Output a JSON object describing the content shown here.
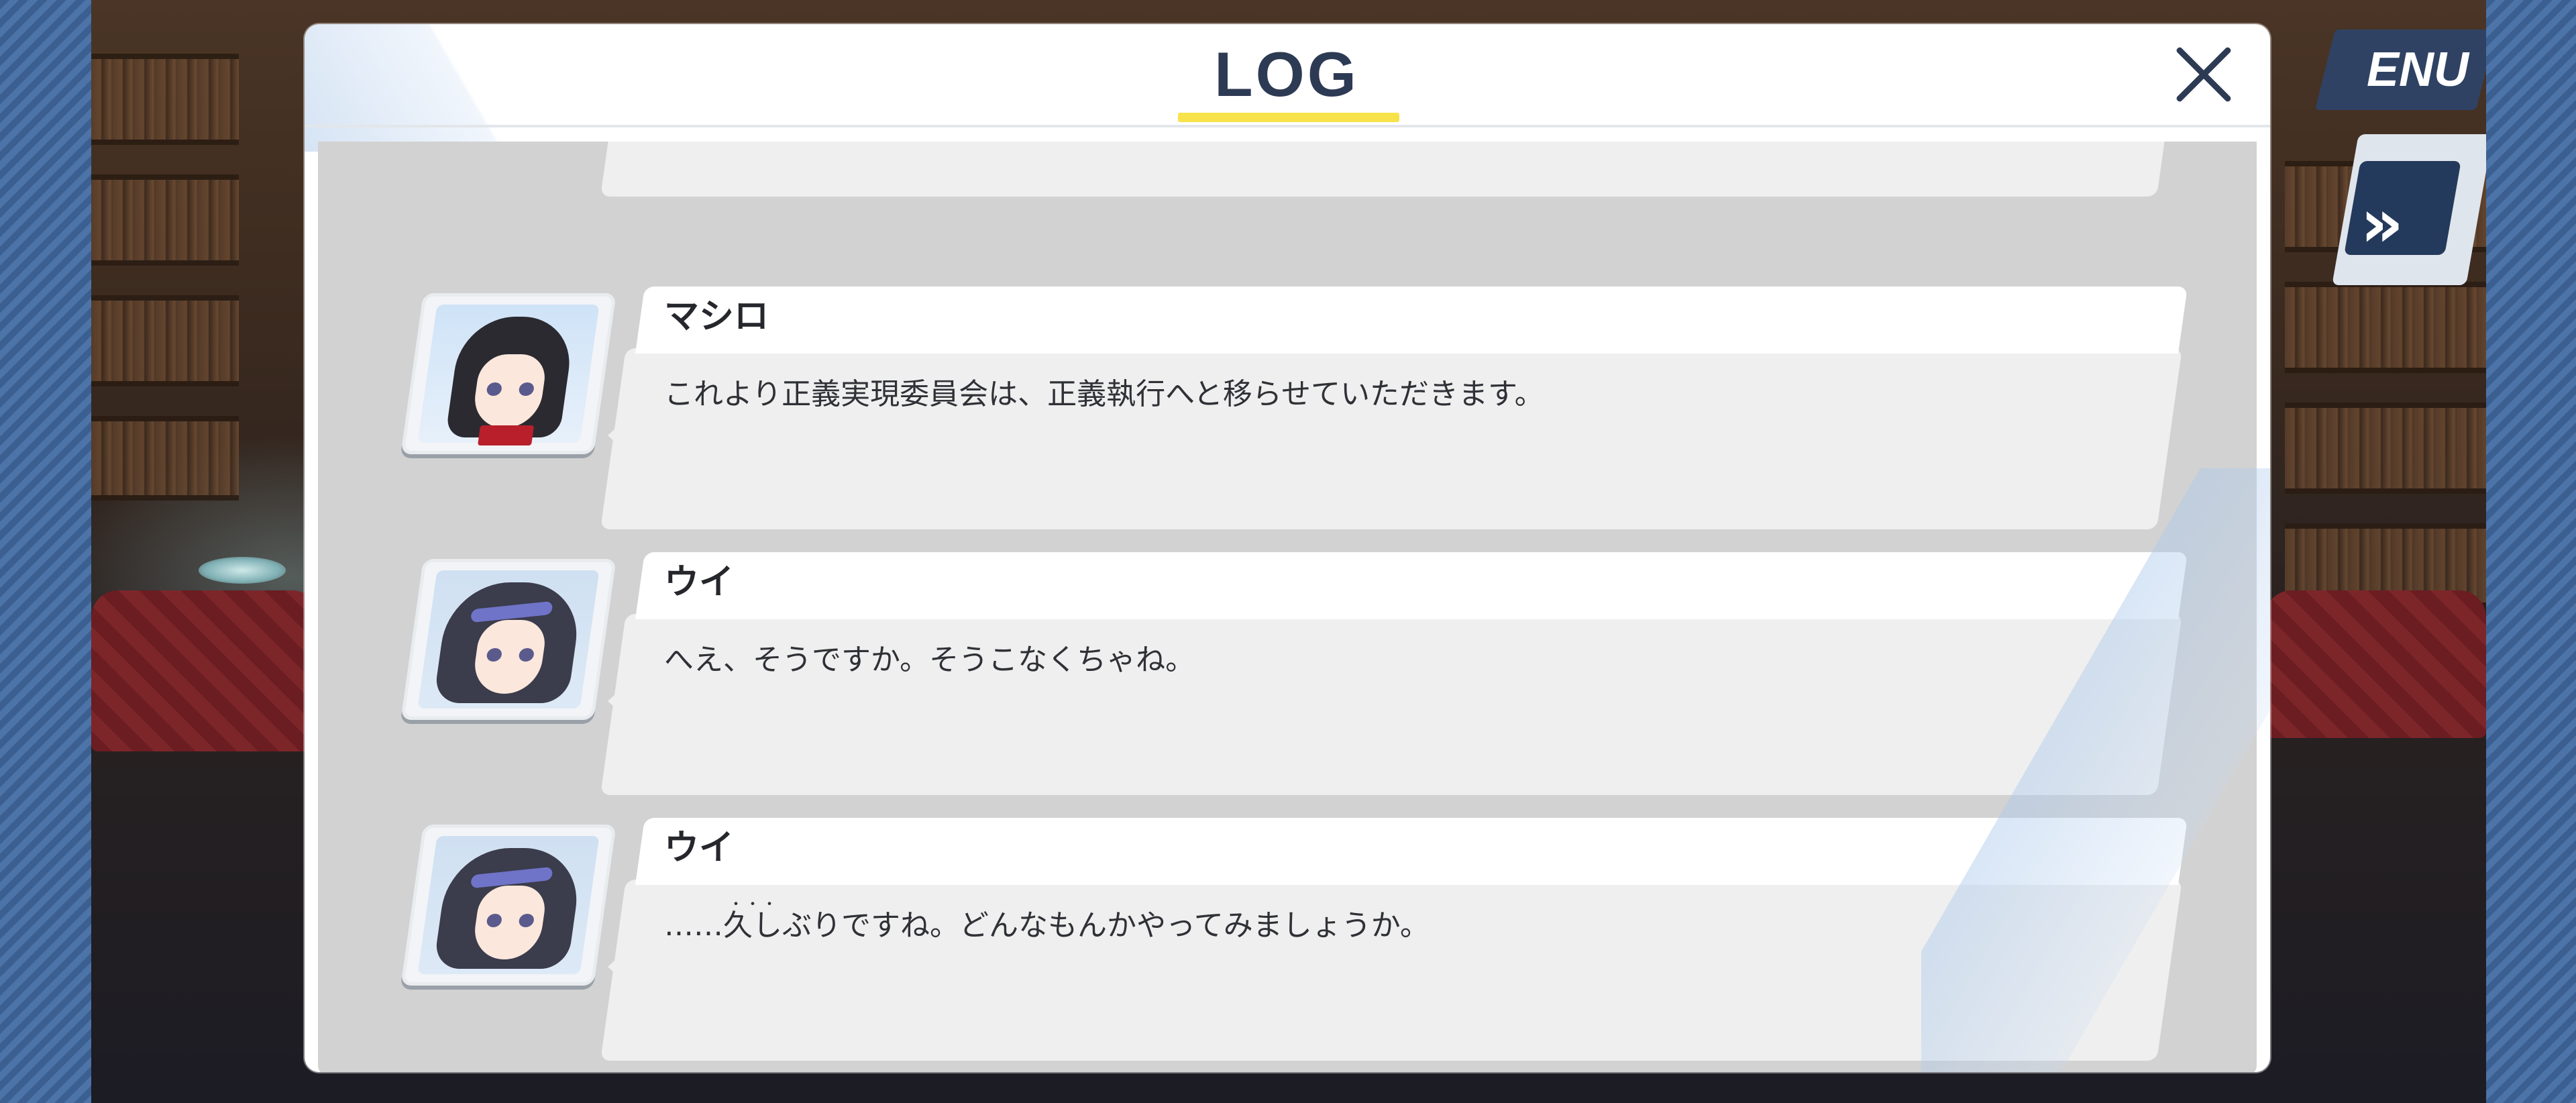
{
  "header": {
    "title": "LOG",
    "close_icon": "close-icon"
  },
  "background_menu": {
    "label": "ENU",
    "fast_forward_glyph": "»"
  },
  "log_entries": [
    {
      "speaker": "",
      "text": ""
    },
    {
      "speaker": "マシロ",
      "text": "これより正義実現委員会は、正義執行へと移らせていただきます。"
    },
    {
      "speaker": "ウイ",
      "text": "へえ、そうですか。そうこなくちゃね。"
    },
    {
      "speaker": "ウイ",
      "text_prefix": "……",
      "text_emphasis": "久しぶり",
      "text_suffix": "ですね。どんなもんかやってみましょうか。"
    }
  ],
  "colors": {
    "title": "#2d3a54",
    "title_underline": "#f7e24b",
    "panel": "#ffffff",
    "list_bg": "#d2d2d2",
    "stripe": "#3b5f91"
  }
}
